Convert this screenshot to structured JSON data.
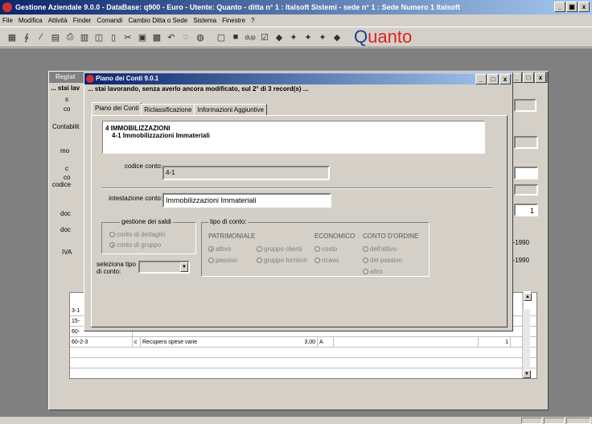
{
  "app": {
    "title": "Gestione Aziendale 9.0.0 - DataBase: q900 - Euro - Utente: Quanto - ditta n° 1 : Italsoft Sistemi - sede n° 1 : Sede Numero 1 Italsoft",
    "brand": "Quanto",
    "window_controls": [
      "_",
      "▣",
      "x"
    ]
  },
  "menu": [
    "File",
    "Modifica",
    "Attività",
    "Finder",
    "Comandi",
    "Cambio Ditta o Sede",
    "Sistema",
    "Finestre",
    "?"
  ],
  "toolbar": {
    "icons": [
      "save-icon",
      "calculator-icon",
      "pencil-icon",
      "page-icon",
      "print-icon",
      "print-preview-icon",
      "copy-icon",
      "delete-icon",
      "cut-icon",
      "paste-icon",
      "clipboard-icon",
      "undo-icon",
      "search-icon",
      "new-page-icon",
      "floppy-icon",
      "dup-icon",
      "edit-icon",
      "first-icon",
      "prev-icon",
      "next-icon",
      "last-icon"
    ],
    "dup_label": "dup"
  },
  "bg_window": {
    "title": "Regist",
    "subtitle_frag": "... stai lav",
    "side_labels": [
      "s",
      "co",
      "Contabilit",
      "mo",
      "c",
      "co",
      "codice",
      "doc",
      "doc",
      "IVA"
    ],
    "right_values": [
      "1",
      "1-1990",
      "1-1990"
    ],
    "grid_rows": [
      {
        "code": "3-1",
        "sign": "",
        "desc": "",
        "amount": "",
        "type": "",
        "num": ""
      },
      {
        "code": "15-",
        "sign": "",
        "desc": "",
        "amount": "",
        "type": "",
        "num": ""
      },
      {
        "code": "60-",
        "sign": "",
        "desc": "",
        "amount": "",
        "type": "",
        "num": ""
      },
      {
        "code": "60-2-3",
        "sign": "c",
        "desc": "Recupero spese varie",
        "amount": "3,00",
        "type": "A",
        "num": "1"
      }
    ]
  },
  "dialog": {
    "title": "Piano dei Conti 9.0.1",
    "status": "... stai lavorando, senza averlo ancora modificato, sul 2° di 3 record(s) ...",
    "tabs": [
      "Piano dei Conti",
      "Riclassificazione",
      "Informazioni Aggiuntive"
    ],
    "header_line1": "4 IMMOBILIZZAZIONI",
    "header_line2": "4-1 Immobilizzazioni Immateriali",
    "codice_label": "codice conto:",
    "codice_value": "4-1",
    "intestazione_label": "intestazione conto:",
    "intestazione_value": "Immobilizzazioni Immateriali",
    "saldi_group": "gestione dei saldi",
    "saldi_options": [
      {
        "label": "conto di dettaglio",
        "selected": false
      },
      {
        "label": "conto di gruppo",
        "selected": true
      }
    ],
    "seleziona_label_1": "seleziona tipo",
    "seleziona_label_2": "di conto:",
    "tipo_group": "tipo di conto:",
    "col_patrimoniale": "PATRIMONIALE",
    "col_economico": "ECONOMICO",
    "col_ordine": "CONTO D'ORDINE",
    "options": [
      {
        "label": "attivo",
        "selected": true
      },
      {
        "label": "passivo",
        "selected": false
      },
      {
        "label": "gruppo clienti",
        "selected": false
      },
      {
        "label": "gruppo fornitori",
        "selected": false
      },
      {
        "label": "costo",
        "selected": false
      },
      {
        "label": "ricavo",
        "selected": false
      },
      {
        "label": "dell'attivo",
        "selected": false
      },
      {
        "label": "del passivo",
        "selected": false
      },
      {
        "label": "altro",
        "selected": false
      }
    ]
  }
}
